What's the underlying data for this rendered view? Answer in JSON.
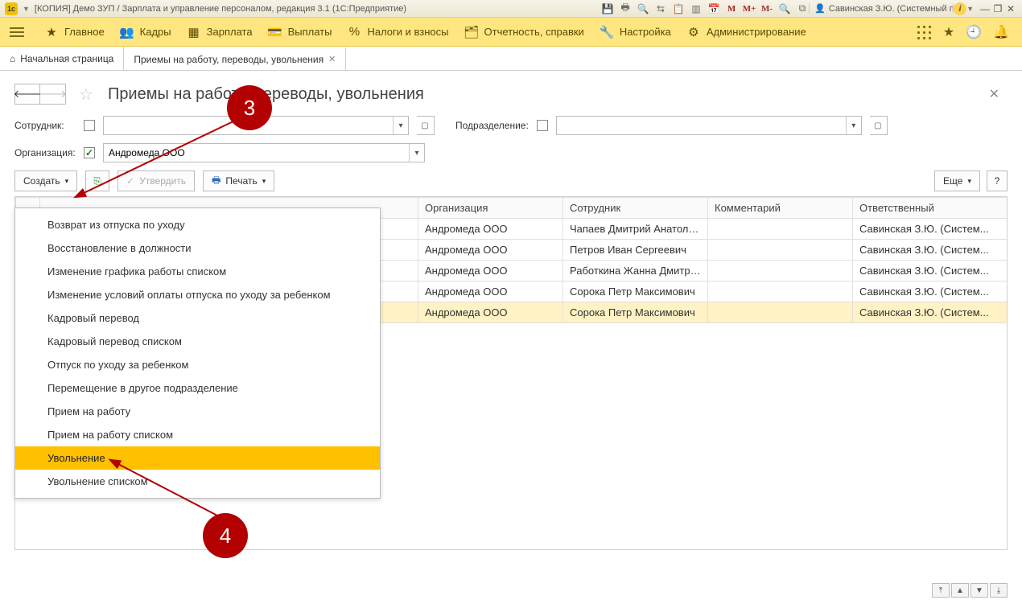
{
  "window": {
    "title": "[КОПИЯ] Демо ЗУП / Зарплата и управление персоналом, редакция 3.1  (1С:Предприятие)",
    "user": "Савинская З.Ю. (Системный прог…"
  },
  "menu": {
    "items": [
      {
        "icon": "★",
        "label": "Главное"
      },
      {
        "icon": "👥",
        "label": "Кадры"
      },
      {
        "icon": "▦",
        "label": "Зарплата"
      },
      {
        "icon": "💳",
        "label": "Выплаты"
      },
      {
        "icon": "%",
        "label": "Налоги и взносы"
      },
      {
        "icon": "🗂",
        "label": "Отчетность, справки"
      },
      {
        "icon": "🔧",
        "label": "Настройка"
      },
      {
        "icon": "⚙",
        "label": "Администрирование"
      }
    ]
  },
  "tabs": {
    "home": "Начальная страница",
    "active": "Приемы на работу, переводы, увольнения"
  },
  "page": {
    "title": "Приемы на работу, переводы, увольнения"
  },
  "filters": {
    "employee_label": "Сотрудник:",
    "dept_label": "Подразделение:",
    "org_label": "Организация:",
    "org_value": "Андромеда ООО"
  },
  "toolbar": {
    "create": "Создать",
    "approve": "Утвердить",
    "print": "Печать",
    "more": "Еще"
  },
  "columns": {
    "org": "Организация",
    "employee": "Сотрудник",
    "comment": "Комментарий",
    "responsible": "Ответственный"
  },
  "rows": [
    {
      "org": "Андромеда ООО",
      "employee": "Чапаев Дмитрий Анатоль...",
      "comment": "",
      "resp": "Савинская З.Ю. (Систем..."
    },
    {
      "org": "Андромеда ООО",
      "employee": "Петров Иван Сергеевич",
      "comment": "",
      "resp": "Савинская З.Ю. (Систем..."
    },
    {
      "org": "Андромеда ООО",
      "employee": "Работкина Жанна Дмитри...",
      "comment": "",
      "resp": "Савинская З.Ю. (Систем..."
    },
    {
      "org": "Андромеда ООО",
      "employee": "Сорока Петр Максимович",
      "comment": "",
      "resp": "Савинская З.Ю. (Систем..."
    },
    {
      "org": "Андромеда ООО",
      "employee": "Сорока Петр Максимович",
      "comment": "",
      "resp": "Савинская З.Ю. (Систем..."
    }
  ],
  "dropdown": {
    "items": [
      "Возврат из отпуска по уходу",
      "Восстановление в должности",
      "Изменение графика работы списком",
      "Изменение условий оплаты отпуска по уходу за ребенком",
      "Кадровый перевод",
      "Кадровый перевод списком",
      "Отпуск по уходу за ребенком",
      "Перемещение в другое подразделение",
      "Прием на работу",
      "Прием на работу списком",
      "Увольнение",
      "Увольнение списком"
    ],
    "highlighted_index": 10
  },
  "annotations": {
    "a3": "3",
    "a4": "4"
  }
}
